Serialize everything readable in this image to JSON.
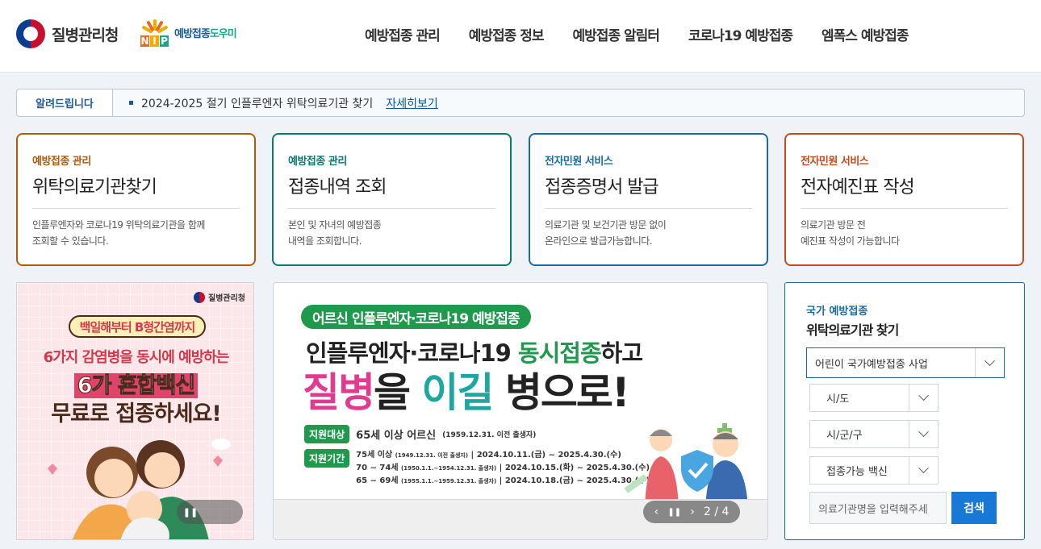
{
  "header": {
    "logo_title": "질병관리청",
    "logo2_text_a": "예방접종",
    "logo2_text_b": "도우미",
    "logo2_badge": [
      "N",
      "I",
      "P"
    ],
    "nav": [
      "예방접종 관리",
      "예방접종 정보",
      "예방접종 알림터",
      "코로나19 예방접종",
      "엠폭스 예방접종"
    ]
  },
  "notice": {
    "tag": "알려드립니다",
    "text": "2024-2025 절기 인플루엔자 위탁의료기관 찾기",
    "link": "자세히보기"
  },
  "cards": [
    {
      "category": "예방접종 관리",
      "title": "위탁의료기관찾기",
      "desc_1": "인플루엔자와 코로나19 위탁의료기관을 함께",
      "desc_2": "조회할 수 있습니다.",
      "color": "#b05a0a"
    },
    {
      "category": "예방접종 관리",
      "title": "접종내역 조회",
      "desc_1": "본인 및 자녀의 예방접종",
      "desc_2": "내역을 조회합니다.",
      "color": "#0a7a6e"
    },
    {
      "category": "전자민원 서비스",
      "title": "접종증명서 발급",
      "desc_1": "의료기관 및 보건기관 방문 없이",
      "desc_2": "온라인으로 발급가능합니다.",
      "color": "#1a6b9e"
    },
    {
      "category": "전자민원 서비스",
      "title": "전자예진표 작성",
      "desc_1": "의료기관 방문 전",
      "desc_2": "예진표 작성이 가능합니다",
      "color": "#c84a1a"
    }
  ],
  "banner1": {
    "agency": "질병관리청",
    "pill": "백일해부터 B형간염까지",
    "line1": "6가지 감염병을 동시에 예방하는",
    "line2": "6가 혼합백신",
    "line3": "무료로 접종하세요!"
  },
  "banner2": {
    "pill": "어르신 인플루엔자·코로나19 예방접종",
    "line1_a": "인플루엔자·코로나19 ",
    "line1_b": "동시접종",
    "line1_c": "하고",
    "line2_a": "질병",
    "line2_b": "을 ",
    "line2_c": "이길",
    "line2_d": " 병으로!",
    "target_tag": "지원대상",
    "target_text": "65세 이상 어르신",
    "target_sub": "(1959.12.31. 이전 출생자)",
    "period_tag": "지원기간",
    "period_rows": [
      {
        "age": "75세 이상",
        "birth": "(1949.12.31. 이전 출생자)",
        "dates": "2024.10.11.(금) ~ 2025.4.30.(수)"
      },
      {
        "age": "70 ~ 74세",
        "birth": "(1950.1.1.~1954.12.31. 출생자)",
        "dates": "2024.10.15.(화) ~ 2025.4.30.(수)"
      },
      {
        "age": "65 ~ 69세",
        "birth": "(1955.1.1.~1959.12.31. 출생자)",
        "dates": "2024.10.18.(금) ~ 2025.4.30.(수)"
      }
    ],
    "pager": "2 / 4"
  },
  "search": {
    "category": "국가 예방접종",
    "title": "위탁의료기관 찾기",
    "program_select": "어린이 국가예방접종 사업",
    "sido": "시/도",
    "sigungu": "시/군/구",
    "vaccine": "접종가능 백신",
    "input_placeholder": "의료기관명을 입력해주세",
    "search_button": "검색"
  }
}
